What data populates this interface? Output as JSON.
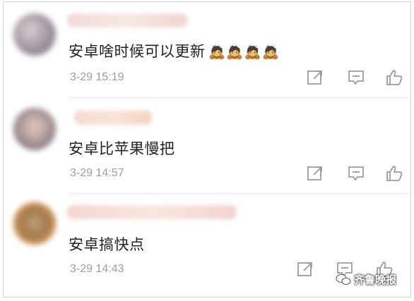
{
  "comments": [
    {
      "text": "安卓啥时候可以更新",
      "emoji": "🙇🙇🙇🙇",
      "time": "3-29 15:19"
    },
    {
      "text": "安卓比苹果慢把",
      "emoji": "",
      "time": "3-29 14:57"
    },
    {
      "text": "安卓搞快点",
      "emoji": "",
      "time": "3-29 14:43"
    }
  ],
  "actions": {
    "share_icon": "share-icon",
    "comment_icon": "comment-icon",
    "like_icon": "like-icon"
  },
  "watermark": {
    "text": "齐鲁晚报"
  },
  "colors": {
    "text": "#222222",
    "time": "#9d9d9d",
    "icon": "#9a9a9a"
  }
}
